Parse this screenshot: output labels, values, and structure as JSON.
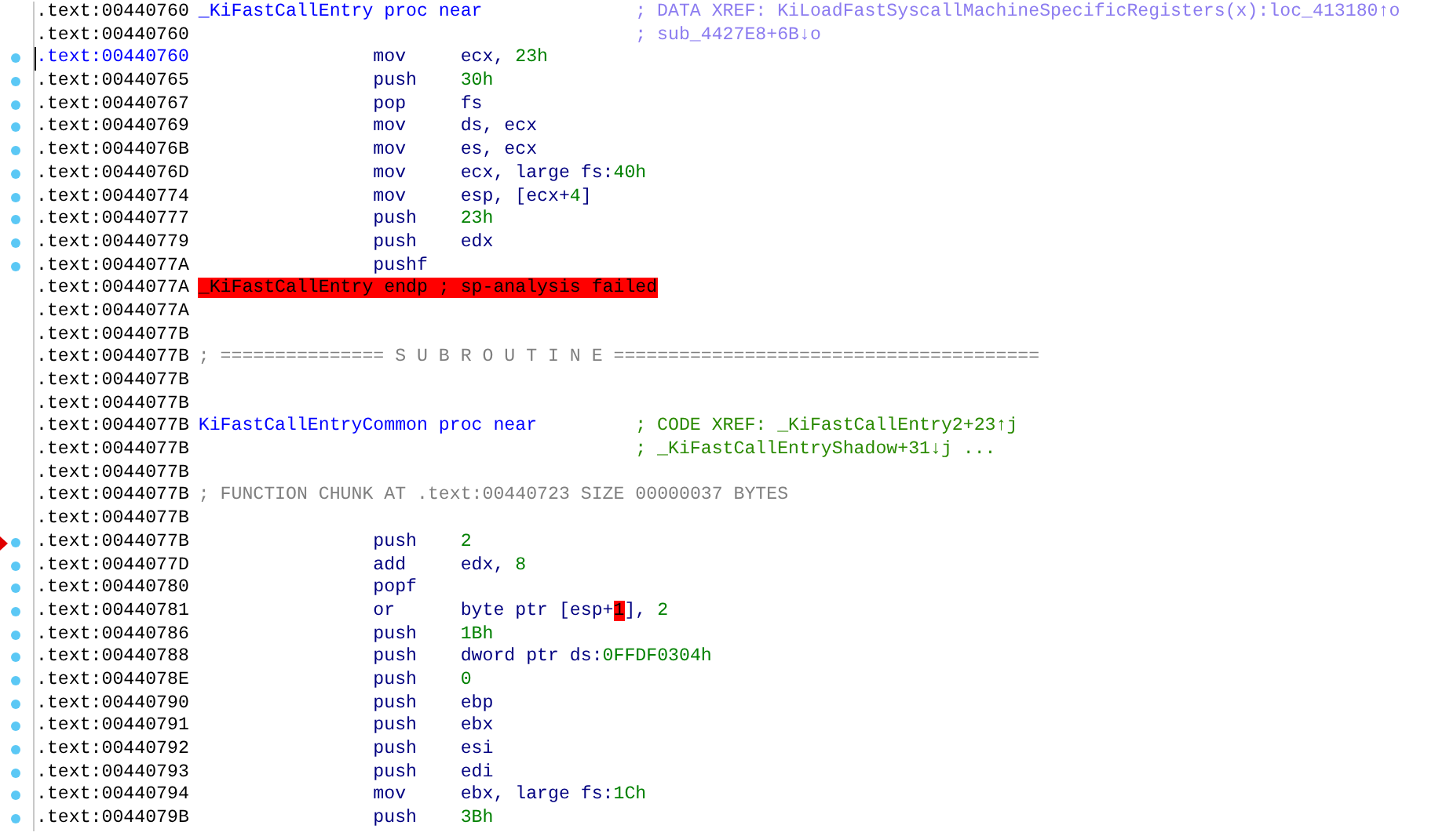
{
  "lines": [
    {
      "address": ".text:00440760",
      "kind": "label",
      "label": "_KiFastCallEntry proc near",
      "comment": "; DATA XREF: KiLoadFastSyscallMachineSpecificRegisters(x):loc_413180↑o",
      "color": "#8c7cf0",
      "marked": false,
      "arrow": false,
      "current": false
    },
    {
      "address": ".text:00440760",
      "kind": "comment",
      "comment": "; sub_4427E8+6B↓o",
      "color": "#8c7cf0",
      "marked": false,
      "arrow": false,
      "current": false
    },
    {
      "address": ".text:00440760",
      "kind": "instr",
      "mnemonic": "mov",
      "operands": [
        {
          "text": "ecx, ",
          "kind": "reg"
        },
        {
          "text": "23h",
          "kind": "num"
        }
      ],
      "marked": true,
      "arrow": false,
      "current": true
    },
    {
      "address": ".text:00440765",
      "kind": "instr",
      "mnemonic": "push",
      "operands": [
        {
          "text": "30h",
          "kind": "num"
        }
      ],
      "marked": true,
      "arrow": false,
      "current": false
    },
    {
      "address": ".text:00440767",
      "kind": "instr",
      "mnemonic": "pop",
      "operands": [
        {
          "text": "fs",
          "kind": "reg"
        }
      ],
      "marked": true,
      "arrow": false,
      "current": false
    },
    {
      "address": ".text:00440769",
      "kind": "instr",
      "mnemonic": "mov",
      "operands": [
        {
          "text": "ds, ecx",
          "kind": "reg"
        }
      ],
      "marked": true,
      "arrow": false,
      "current": false
    },
    {
      "address": ".text:0044076B",
      "kind": "instr",
      "mnemonic": "mov",
      "operands": [
        {
          "text": "es, ecx",
          "kind": "reg"
        }
      ],
      "marked": true,
      "arrow": false,
      "current": false
    },
    {
      "address": ".text:0044076D",
      "kind": "instr",
      "mnemonic": "mov",
      "operands": [
        {
          "text": "ecx, large fs:",
          "kind": "reg"
        },
        {
          "text": "40h",
          "kind": "num"
        }
      ],
      "marked": true,
      "arrow": false,
      "current": false
    },
    {
      "address": ".text:00440774",
      "kind": "instr",
      "mnemonic": "mov",
      "operands": [
        {
          "text": "esp, [ecx+",
          "kind": "reg"
        },
        {
          "text": "4",
          "kind": "num"
        },
        {
          "text": "]",
          "kind": "reg"
        }
      ],
      "marked": true,
      "arrow": false,
      "current": false
    },
    {
      "address": ".text:00440777",
      "kind": "instr",
      "mnemonic": "push",
      "operands": [
        {
          "text": "23h",
          "kind": "num"
        }
      ],
      "marked": true,
      "arrow": false,
      "current": false
    },
    {
      "address": ".text:00440779",
      "kind": "instr",
      "mnemonic": "push",
      "operands": [
        {
          "text": "edx",
          "kind": "reg"
        }
      ],
      "marked": true,
      "arrow": false,
      "current": false
    },
    {
      "address": ".text:0044077A",
      "kind": "instr",
      "mnemonic": "pushf",
      "marked": true,
      "arrow": false,
      "current": false
    },
    {
      "address": ".text:0044077A",
      "kind": "endp",
      "label": "_KiFastCallEntry endp ; sp-analysis failed",
      "marked": false,
      "arrow": false,
      "current": false
    },
    {
      "address": ".text:0044077A",
      "kind": "blank",
      "marked": false,
      "arrow": false,
      "current": false
    },
    {
      "address": ".text:0044077B",
      "kind": "blank",
      "marked": false,
      "arrow": false,
      "current": false
    },
    {
      "address": ".text:0044077B",
      "kind": "note",
      "label": "; =============== S U B R O U T I N E =======================================",
      "marked": false,
      "arrow": false,
      "current": false
    },
    {
      "address": ".text:0044077B",
      "kind": "blank",
      "marked": false,
      "arrow": false,
      "current": false
    },
    {
      "address": ".text:0044077B",
      "kind": "blank",
      "marked": false,
      "arrow": false,
      "current": false
    },
    {
      "address": ".text:0044077B",
      "kind": "label",
      "label": "KiFastCallEntryCommon proc near",
      "comment": "; CODE XREF: _KiFastCallEntry2+23↑j",
      "color": "#2a8a00",
      "marked": false,
      "arrow": false,
      "current": false
    },
    {
      "address": ".text:0044077B",
      "kind": "comment",
      "comment": "; _KiFastCallEntryShadow+31↓j ...",
      "color": "#2a8a00",
      "marked": false,
      "arrow": false,
      "current": false
    },
    {
      "address": ".text:0044077B",
      "kind": "blank",
      "marked": false,
      "arrow": false,
      "current": false
    },
    {
      "address": ".text:0044077B",
      "kind": "note",
      "label": "; FUNCTION CHUNK AT .text:00440723 SIZE 00000037 BYTES",
      "marked": false,
      "arrow": false,
      "current": false
    },
    {
      "address": ".text:0044077B",
      "kind": "blank",
      "marked": false,
      "arrow": false,
      "current": false
    },
    {
      "address": ".text:0044077B",
      "kind": "instr",
      "mnemonic": "push",
      "operands": [
        {
          "text": "2",
          "kind": "num"
        }
      ],
      "marked": true,
      "arrow": true,
      "current": false
    },
    {
      "address": ".text:0044077D",
      "kind": "instr",
      "mnemonic": "add",
      "operands": [
        {
          "text": "edx, ",
          "kind": "reg"
        },
        {
          "text": "8",
          "kind": "num"
        }
      ],
      "marked": true,
      "arrow": false,
      "current": false
    },
    {
      "address": ".text:00440780",
      "kind": "instr",
      "mnemonic": "popf",
      "marked": true,
      "arrow": false,
      "current": false
    },
    {
      "address": ".text:00440781",
      "kind": "instr",
      "mnemonic": "or",
      "operands": [
        {
          "text": "byte ptr [esp+",
          "kind": "reg"
        },
        {
          "text": "1",
          "kind": "hl"
        },
        {
          "text": "], ",
          "kind": "reg"
        },
        {
          "text": "2",
          "kind": "num"
        }
      ],
      "marked": true,
      "arrow": false,
      "current": false
    },
    {
      "address": ".text:00440786",
      "kind": "instr",
      "mnemonic": "push",
      "operands": [
        {
          "text": "1Bh",
          "kind": "num"
        }
      ],
      "marked": true,
      "arrow": false,
      "current": false
    },
    {
      "address": ".text:00440788",
      "kind": "instr",
      "mnemonic": "push",
      "operands": [
        {
          "text": "dword ptr ds:",
          "kind": "reg"
        },
        {
          "text": "0FFDF0304h",
          "kind": "num"
        }
      ],
      "marked": true,
      "arrow": false,
      "current": false
    },
    {
      "address": ".text:0044078E",
      "kind": "instr",
      "mnemonic": "push",
      "operands": [
        {
          "text": "0",
          "kind": "num"
        }
      ],
      "marked": true,
      "arrow": false,
      "current": false
    },
    {
      "address": ".text:00440790",
      "kind": "instr",
      "mnemonic": "push",
      "operands": [
        {
          "text": "ebp",
          "kind": "reg"
        }
      ],
      "marked": true,
      "arrow": false,
      "current": false
    },
    {
      "address": ".text:00440791",
      "kind": "instr",
      "mnemonic": "push",
      "operands": [
        {
          "text": "ebx",
          "kind": "reg"
        }
      ],
      "marked": true,
      "arrow": false,
      "current": false
    },
    {
      "address": ".text:00440792",
      "kind": "instr",
      "mnemonic": "push",
      "operands": [
        {
          "text": "esi",
          "kind": "reg"
        }
      ],
      "marked": true,
      "arrow": false,
      "current": false
    },
    {
      "address": ".text:00440793",
      "kind": "instr",
      "mnemonic": "push",
      "operands": [
        {
          "text": "edi",
          "kind": "reg"
        }
      ],
      "marked": true,
      "arrow": false,
      "current": false
    },
    {
      "address": ".text:00440794",
      "kind": "instr",
      "mnemonic": "mov",
      "operands": [
        {
          "text": "ebx, large fs:",
          "kind": "reg"
        },
        {
          "text": "1Ch",
          "kind": "num"
        }
      ],
      "marked": true,
      "arrow": false,
      "current": false
    },
    {
      "address": ".text:0044079B",
      "kind": "instr",
      "mnemonic": "push",
      "operands": [
        {
          "text": "3Bh",
          "kind": "num"
        }
      ],
      "marked": true,
      "arrow": false,
      "current": false
    }
  ]
}
